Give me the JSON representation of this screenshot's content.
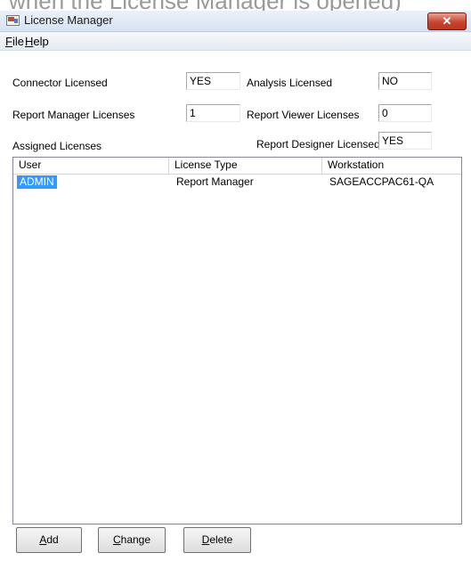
{
  "window": {
    "title": "License Manager",
    "close_label": "✕"
  },
  "menu": [
    {
      "label": "File",
      "underline": "F"
    },
    {
      "label": "Help",
      "underline": "H"
    }
  ],
  "fields": {
    "connector_licensed": {
      "label": "Connector Licensed",
      "value": "YES"
    },
    "analysis_licensed": {
      "label": "Analysis Licensed",
      "value": "NO"
    },
    "report_manager_licenses": {
      "label": "Report Manager Licenses",
      "value": "1"
    },
    "report_viewer_licenses": {
      "label": "Report Viewer Licenses",
      "value": "0"
    },
    "report_designer_licensed": {
      "label": "Report Designer Licensed",
      "value": "YES"
    }
  },
  "assigned_licenses_label": "Assigned Licenses",
  "table": {
    "columns": [
      "User",
      "License Type",
      "Workstation"
    ],
    "rows": [
      {
        "user": "ADMIN",
        "license_type": "Report Manager",
        "workstation": "SAGEACCPAC61-QA",
        "selected": true
      }
    ]
  },
  "buttons": {
    "add": "Add",
    "change": "Change",
    "delete": "Delete"
  }
}
